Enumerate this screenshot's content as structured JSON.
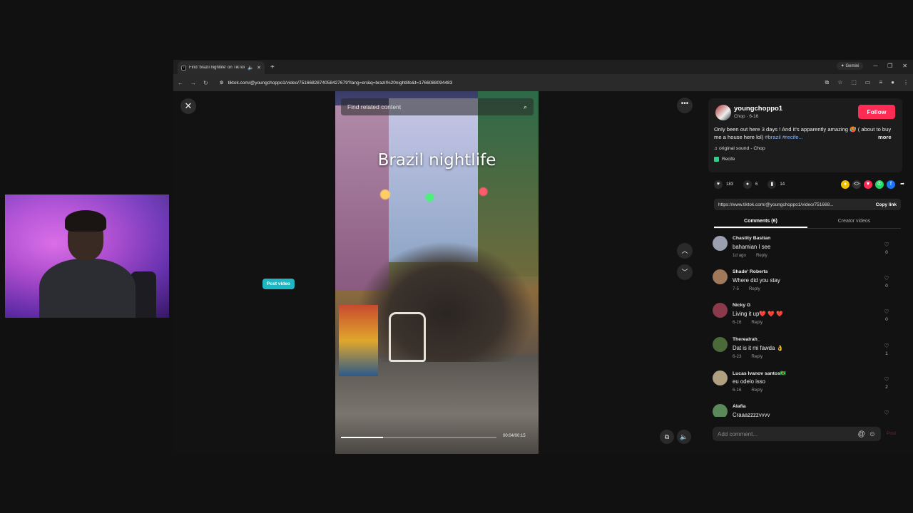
{
  "browser": {
    "tab_title": "Find 'brazil nightlife' on TikTok",
    "new_tab": "+",
    "gemini_label": "Gemini",
    "url": "tiktok.com/@youngchoppo1/video/7516682874058427679?lang=en&q=brazil%20nightlife&t=1766088094483"
  },
  "video": {
    "search_placeholder": "Find related content",
    "caption": "Brazil nightlife",
    "timecode": "00:04/00:15",
    "progress_fraction": 0.27,
    "post_video_label": "Post video"
  },
  "author": {
    "username": "youngchoppo1",
    "meta": "Chop · 6-16",
    "follow_label": "Follow",
    "description": "Only been out here 3 days ! And it's apparently amazing 🥵 ( about to buy me a house here lol)",
    "hashtags": "#brazil #recife...",
    "more_label": "more",
    "sound": "original sound - Chop",
    "location": "Recife"
  },
  "stats": {
    "likes": "183",
    "comments": "6",
    "saves": "14"
  },
  "share": {
    "link": "https://www.tiktok.com/@youngchoppo1/video/751668...",
    "copy_label": "Copy link"
  },
  "tabs": {
    "comments": "Comments (6)",
    "creator": "Creator videos"
  },
  "comments": [
    {
      "name": "Chastity Bastian",
      "text": "bahamian I see",
      "date": "1d ago",
      "reply": "Reply",
      "likes": "0",
      "color": "#9aa0b0"
    },
    {
      "name": "Shade' Roberts",
      "text": "Where did you stay",
      "date": "7-5",
      "reply": "Reply",
      "likes": "0",
      "color": "#a0785a"
    },
    {
      "name": "Nicky G",
      "text": "Living it up❤️ ❤️ ❤️",
      "date": "6-16",
      "reply": "Reply",
      "likes": "0",
      "color": "#8a3a4a"
    },
    {
      "name": "Therealrah_",
      "text": "Dat is it mi fawda 👌",
      "date": "6-23",
      "reply": "Reply",
      "likes": "1",
      "color": "#4a6a3a"
    },
    {
      "name": "Lucas Ivanov santos🇧🇷",
      "text": "eu odeio isso",
      "date": "6-16",
      "reply": "Reply",
      "likes": "2",
      "color": "#b0a080"
    },
    {
      "name": "Alafia",
      "text": "Craaazzzzyyyy",
      "date": "",
      "reply": "",
      "likes": "",
      "color": "#5a8a5a"
    }
  ],
  "comment_input": {
    "placeholder": "Add comment...",
    "post_label": "Post"
  },
  "colors": {
    "follow": "#fe2c55",
    "post_video": "#1fb6c4",
    "hashtag": "#8ab4f8"
  }
}
